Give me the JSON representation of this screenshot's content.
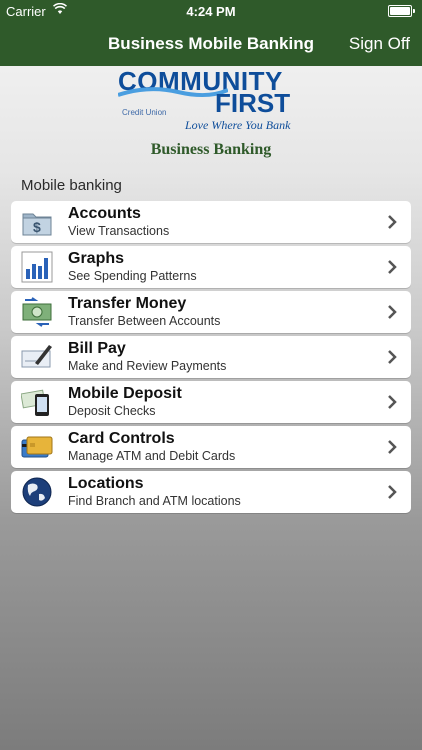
{
  "status": {
    "carrier": "Carrier",
    "time": "4:24 PM"
  },
  "navbar": {
    "title": "Business Mobile Banking",
    "right_button": "Sign Off"
  },
  "logo": {
    "line1": "COMMUNITY",
    "line2": "FIRST",
    "credit_union": "Credit Union",
    "tagline": "Love Where You Bank",
    "subtitle": "Business Banking",
    "brand_blue": "#0e4d9a"
  },
  "section_label": "Mobile banking",
  "menu": [
    {
      "title": "Accounts",
      "subtitle": "View Transactions",
      "icon": "folder-dollar-icon"
    },
    {
      "title": "Graphs",
      "subtitle": "See Spending Patterns",
      "icon": "bar-chart-icon"
    },
    {
      "title": "Transfer Money",
      "subtitle": "Transfer Between Accounts",
      "icon": "money-transfer-icon"
    },
    {
      "title": "Bill Pay",
      "subtitle": "Make and Review Payments",
      "icon": "check-pen-icon"
    },
    {
      "title": "Mobile Deposit",
      "subtitle": "Deposit Checks",
      "icon": "phone-check-icon"
    },
    {
      "title": "Card Controls",
      "subtitle": "Manage ATM and Debit Cards",
      "icon": "credit-card-icon"
    },
    {
      "title": "Locations",
      "subtitle": "Find Branch and ATM locations",
      "icon": "globe-icon"
    }
  ],
  "colors": {
    "navbar": "#2f5a2a"
  }
}
